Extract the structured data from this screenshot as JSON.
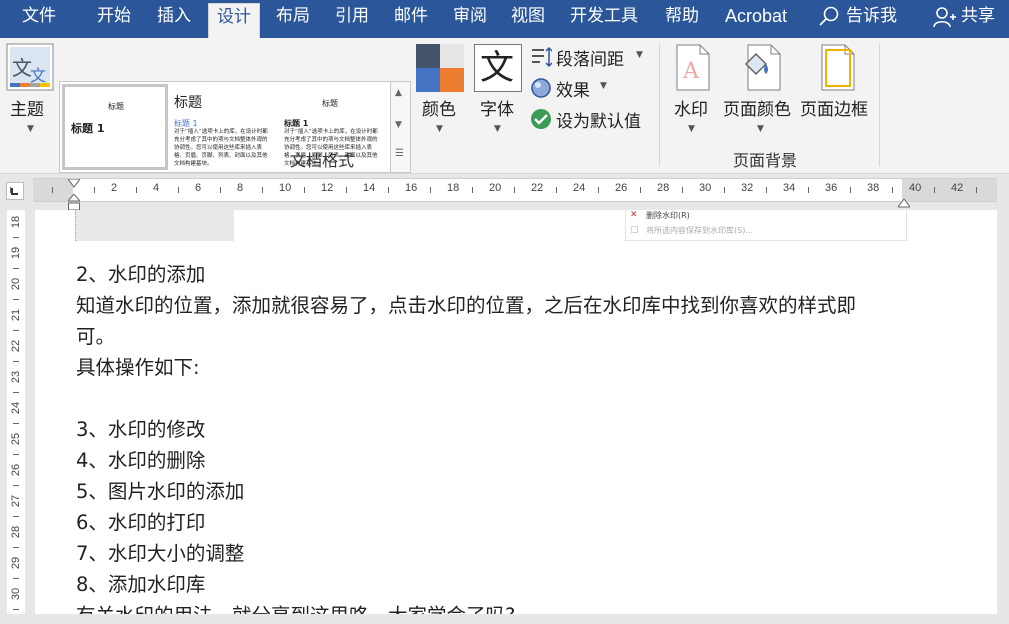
{
  "tabs": [
    "文件",
    "开始",
    "插入",
    "设计",
    "布局",
    "引用",
    "邮件",
    "审阅",
    "视图",
    "开发工具",
    "帮助",
    "Acrobat"
  ],
  "active_tab": "设计",
  "tell_me": "告诉我",
  "share": "共享",
  "ribbon": {
    "theme_label": "主题",
    "gallery": {
      "item1": {
        "title": "标题",
        "heading": "标题 1"
      },
      "item2": {
        "title": "标题",
        "heading": "标题 1",
        "body": "对于“插入”选项卡上的库，在设计时都充分考虑了其中的项与文档整体外观的协调性。您可以使用这些库来插入表格、页眉、页脚、列表、封面以及其他文档构建基块。"
      },
      "item3": {
        "title": "标题",
        "heading": "标题 1",
        "body": "对于“插入”选项卡上的库，在设计时都充分考虑了其中的项与文档整体外观的协调性。您可以使用这些库来插入表格、页眉、页脚、列表、封面以及其他文档构建基块。"
      }
    },
    "colors_label": "颜色",
    "font_label": "字体",
    "font_glyph": "文",
    "paragraph_spacing": "段落间距",
    "effects": "效果",
    "set_default": "设为默认值",
    "group_document_format": "文档格式",
    "watermark": "水印",
    "page_color": "页面颜色",
    "page_borders": "页面边框",
    "group_page_background": "页面背景",
    "colors": {
      "accent": "#2b579a",
      "theme_swatch_1": "#44546a",
      "theme_swatch_2": "#e7e6e6",
      "theme_swatch_3": "#4472c4",
      "theme_swatch_4": "#ed7d31",
      "check_green": "#3b9b54"
    }
  },
  "ruler": {
    "numbers": [
      "2",
      "4",
      "6",
      "8",
      "10",
      "12",
      "14",
      "16",
      "18",
      "20",
      "22",
      "24",
      "26",
      "28",
      "30",
      "32",
      "34",
      "36",
      "38",
      "40",
      "42"
    ],
    "vertical_numbers": [
      "18",
      "19",
      "20",
      "21",
      "22",
      "23",
      "24",
      "25",
      "26",
      "27",
      "28",
      "29",
      "30"
    ]
  },
  "snippet": {
    "remove_watermark": "删除水印(R)",
    "save_to_gallery": "将所选内容保存到水印库(S)..."
  },
  "document": {
    "paragraphs": [
      "2、水印的添加",
      "知道水印的位置，添加就很容易了，点击水印的位置，之后在水印库中找到你喜欢的样式即",
      "可。",
      "具体操作如下:",
      "",
      "3、水印的修改",
      "4、水印的删除",
      "5、图片水印的添加",
      "6、水印的打印",
      "7、水印大小的调整",
      "8、添加水印库",
      "有关水印的用法，就分享到这里咯，大家学会了吗?"
    ]
  }
}
